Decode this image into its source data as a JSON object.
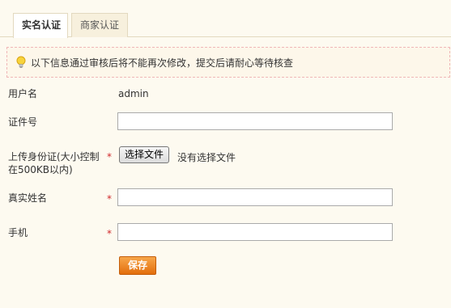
{
  "tabs": [
    {
      "label": "实名认证",
      "active": true
    },
    {
      "label": "商家认证",
      "active": false
    }
  ],
  "notice": {
    "icon": "lightbulb-icon",
    "text": "以下信息通过审核后将不能再次修改，提交后请耐心等待核查"
  },
  "form": {
    "username_label": "用户名",
    "username_value": "admin",
    "id_number_label": "证件号",
    "id_number_value": "",
    "upload_label": "上传身份证(大小控制在500KB以内)",
    "upload_required": "*",
    "upload_button": "选择文件",
    "upload_status": "没有选择文件",
    "realname_label": "真实姓名",
    "realname_required": "*",
    "realname_value": "",
    "phone_label": "手机",
    "phone_required": "*",
    "phone_value": "",
    "save_label": "保存"
  },
  "colors": {
    "background": "#fdfaf0",
    "required": "#d0282b",
    "save_button": "#e36e0d",
    "notice_border": "#f0b7b7"
  }
}
